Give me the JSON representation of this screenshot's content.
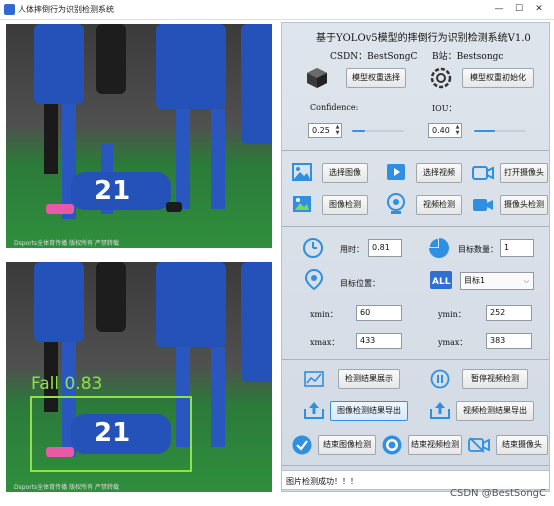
{
  "window": {
    "title": "人体摔倒行为识别检测系统",
    "minimize": "—",
    "maximize": "☐",
    "close": "✕"
  },
  "images": {
    "source": {
      "watermark": "Dsports全体育传播  版权所有  严禁转载",
      "jersey": "21"
    },
    "result": {
      "watermark": "Dsports全体育传播  版权所有  严禁转载",
      "jersey": "21",
      "detection_label": "Fall  0.83"
    }
  },
  "header": {
    "title": "基于YOLOv5模型的摔倒行为识别检测系统V1.0",
    "csdn": "CSDN：BestSongC",
    "bilibili": "B站：Bestsongc"
  },
  "model": {
    "select_label": "模型权重选择",
    "init_label": "模型权重初始化"
  },
  "params": {
    "confidence_label": "Confidence:",
    "confidence_value": "0.25",
    "confidence_level": 0.25,
    "iou_label": "IOU：",
    "iou_value": "0.40",
    "iou_level": 0.4
  },
  "media": {
    "select_image": "选择图像",
    "select_video": "选择视频",
    "open_camera": "打开摄像头",
    "detect_image": "图像检测",
    "detect_video": "视频检测",
    "detect_camera": "摄像头检测"
  },
  "stats": {
    "time_label": "用时：",
    "time_value": "0.81",
    "count_label": "目标数量：",
    "count_value": "1",
    "position_label": "目标位置：",
    "target_select": "目标1",
    "xmin_label": "xmin：",
    "xmin_value": "60",
    "ymin_label": "ymin：",
    "ymin_value": "252",
    "xmax_label": "xmax：",
    "xmax_value": "433",
    "ymax_label": "ymax：",
    "ymax_value": "383"
  },
  "actions": {
    "show_result": "检测结果展示",
    "pause_video": "暂停视频检测",
    "export_image": "图像检测结果导出",
    "export_video": "视频检测结果导出",
    "end_image": "结束图像检测",
    "end_video": "结束视频检测",
    "end_camera": "结束摄像头"
  },
  "status": {
    "message": "图片检测成功！！！"
  },
  "watermark": "CSDN @BestSongC",
  "colors": {
    "accent": "#2f8fe0",
    "bbox": "#8fe34a"
  }
}
